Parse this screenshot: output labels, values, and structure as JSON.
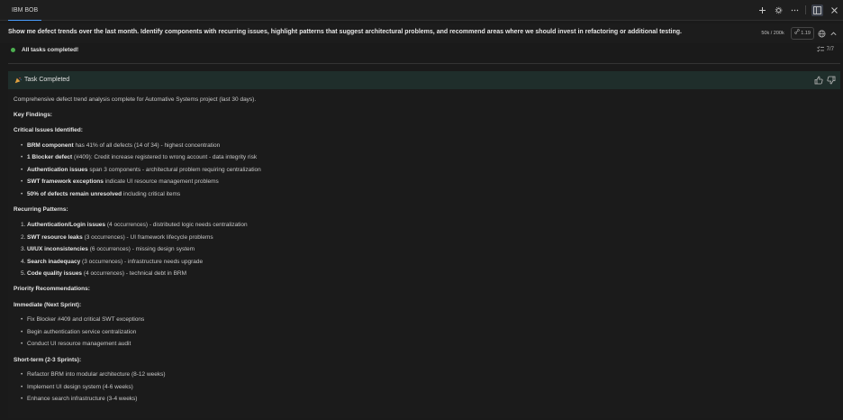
{
  "tab": {
    "label": "IBM BOB"
  },
  "tab_actions": [
    "plus-icon",
    "gear-icon",
    "more-icon",
    "layout-icon",
    "close-icon"
  ],
  "prompt": {
    "text": "Show me defect trends over the last month. Identify components with recurring issues, highlight patterns that suggest architectural problems, and recommend areas where we should invest in refactoring or additional testing.",
    "tokens": "50k / 200k",
    "attach": "1.19"
  },
  "status": {
    "text": "All tasks completed!",
    "progress": "7/7"
  },
  "card": {
    "title": "Task Completed"
  },
  "content": {
    "intro": "Comprehensive defect trend analysis complete for Automative Systems project (last 30 days).",
    "key_findings": "Key Findings:",
    "critical_heading": "Critical Issues Identified:",
    "critical": [
      {
        "bold": "BRM component",
        "rest": " has 41% of all defects (14 of 34) - highest concentration"
      },
      {
        "bold": "1 Blocker defect",
        "rest": " (#409): Credit increase registered to wrong account - data integrity risk"
      },
      {
        "bold": "Authentication issues",
        "rest": " span 3 components - architectural problem requiring centralization"
      },
      {
        "bold": "SWT framework exceptions",
        "rest": " indicate UI resource management problems"
      },
      {
        "bold": "50% of defects remain unresolved",
        "rest": " including critical items"
      }
    ],
    "recurring_heading": "Recurring Patterns:",
    "recurring": [
      {
        "num": "1.",
        "bold": "Authentication/Login issues",
        "rest": " (4 occurrences) - distributed logic needs centralization"
      },
      {
        "num": "2.",
        "bold": "SWT resource leaks",
        "rest": " (3 occurrences) - UI framework lifecycle problems"
      },
      {
        "num": "3.",
        "bold": "UI/UX inconsistencies",
        "rest": " (6 occurrences) - missing design system"
      },
      {
        "num": "4.",
        "bold": "Search inadequacy",
        "rest": " (3 occurrences) - infrastructure needs upgrade"
      },
      {
        "num": "5.",
        "bold": "Code quality issues",
        "rest": " (4 occurrences) - technical debt in BRM"
      }
    ],
    "priority_heading": "Priority Recommendations:",
    "immediate_heading": "Immediate (Next Sprint):",
    "immediate": [
      "Fix Blocker #409 and critical SWT exceptions",
      "Begin authentication service centralization",
      "Conduct UI resource management audit"
    ],
    "short_heading": "Short-term (2-3 Sprints):",
    "short": [
      "Refactor BRM into modular architecture (8-12 weeks)",
      "Implement UI design system (4-6 weeks)",
      "Enhance search infrastructure (3-4 weeks)"
    ]
  }
}
